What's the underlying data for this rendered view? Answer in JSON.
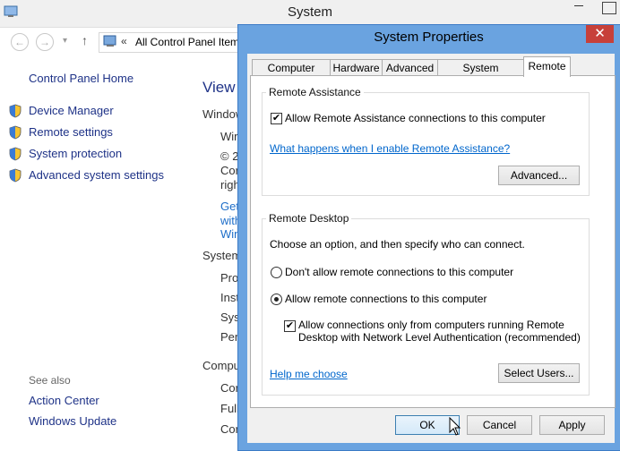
{
  "system_window": {
    "title": "System",
    "address_text": "All Control Panel Item",
    "address_prefix": "«",
    "nav": {
      "back": "←",
      "forward": "→",
      "dropdown": "▾",
      "up": "↑"
    },
    "sidebar": {
      "home": "Control Panel Home",
      "items": [
        {
          "label": "Device Manager"
        },
        {
          "label": "Remote settings"
        },
        {
          "label": "System protection"
        },
        {
          "label": "Advanced system settings"
        }
      ],
      "see_also": "See also",
      "see_also_items": [
        {
          "label": "Action Center"
        },
        {
          "label": "Windows Update"
        }
      ]
    },
    "content": {
      "view": "View",
      "windows": "Window",
      "win_fragments": [
        "Wir",
        "© 2",
        "Cor",
        "righ"
      ],
      "get_fragments": [
        "Get",
        "with",
        "Win"
      ],
      "system_heading": "System",
      "system_fragments": [
        "Pro",
        "Inst",
        "Syst",
        "Pen"
      ],
      "computer_heading": "Compu",
      "computer_fragments": [
        "Cor",
        "Full",
        "Cor"
      ]
    }
  },
  "dialog": {
    "title": "System Properties",
    "close": "✕",
    "tabs": [
      {
        "label": "Computer Name"
      },
      {
        "label": "Hardware"
      },
      {
        "label": "Advanced"
      },
      {
        "label": "System Protection"
      },
      {
        "label": "Remote",
        "active": true
      }
    ],
    "remote_assistance": {
      "title": "Remote Assistance",
      "allow_label": "Allow Remote Assistance connections to this computer",
      "allow_checked": true,
      "link": "What happens when I enable Remote Assistance?",
      "advanced_button": "Advanced..."
    },
    "remote_desktop": {
      "title": "Remote Desktop",
      "intro": "Choose an option, and then specify who can connect.",
      "option_none": "Don't allow remote connections to this computer",
      "option_allow": "Allow remote connections to this computer",
      "selected": "allow",
      "nla_line1": "Allow connections only from computers running Remote",
      "nla_line2": "Desktop with Network Level Authentication (recommended)",
      "nla_checked": true,
      "help_link": "Help me choose",
      "select_users_button": "Select Users..."
    },
    "buttons": {
      "ok": "OK",
      "cancel": "Cancel",
      "apply": "Apply"
    }
  }
}
